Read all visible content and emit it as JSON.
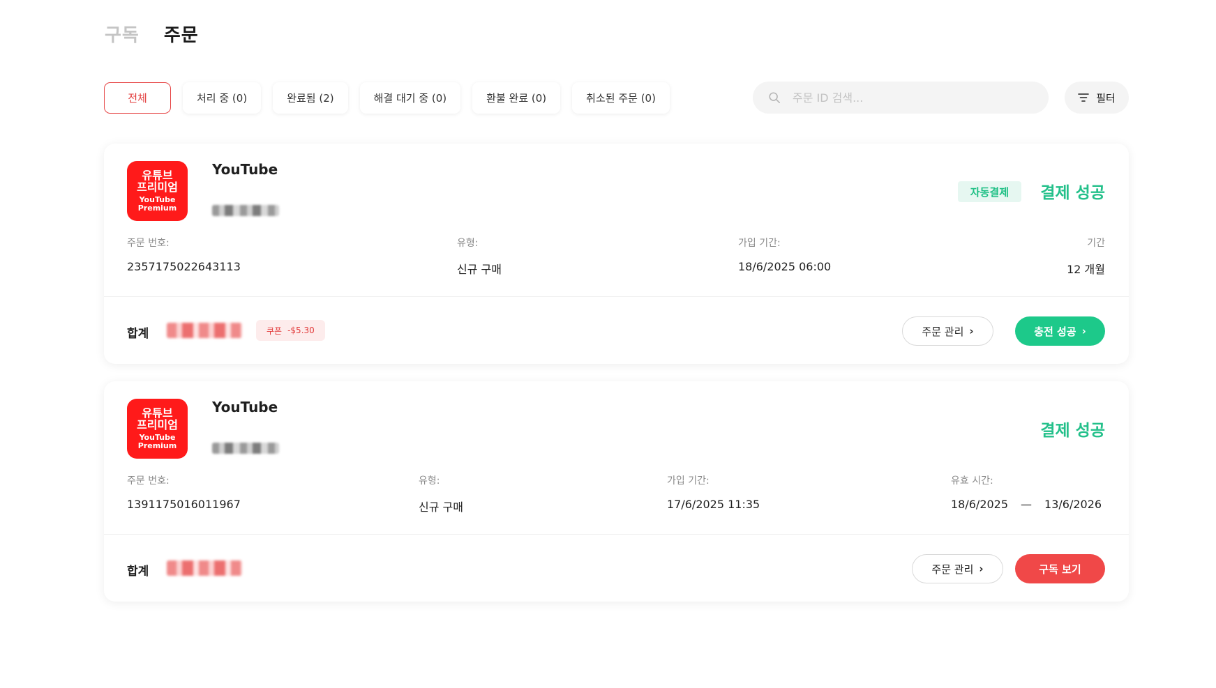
{
  "header": {
    "tabs": [
      {
        "label": "구독",
        "active": false
      },
      {
        "label": "주문",
        "active": true
      }
    ]
  },
  "filters": [
    {
      "label": "전체",
      "active": true
    },
    {
      "label": "처리 중 (0)",
      "active": false
    },
    {
      "label": "완료됨 (2)",
      "active": false
    },
    {
      "label": "해결 대기 중 (0)",
      "active": false
    },
    {
      "label": "환불 완료 (0)",
      "active": false
    },
    {
      "label": "취소된 주문 (0)",
      "active": false
    }
  ],
  "search": {
    "placeholder": "주문 ID 검색...",
    "value": "",
    "icon": "search-icon"
  },
  "filter_button": {
    "label": "필터",
    "icon": "filter-icon"
  },
  "colors": {
    "brand_red": "#e23b3b",
    "success_green": "#23c08a",
    "logo_red": "#ff1a1a"
  },
  "orders": [
    {
      "logo": {
        "line1": "유튜브",
        "line2": "프리미엄",
        "line3": "YouTube",
        "line4": "Premium"
      },
      "service": "YouTube",
      "badge": "자동결제",
      "status": "결제 성공",
      "fields": {
        "order_no_label": "주문 번호:",
        "order_no": "2357175022643113",
        "type_label": "유형:",
        "type": "신규 구매",
        "joined_label": "가입 기간:",
        "joined": "18/6/2025 06:00",
        "period_label": "기간",
        "period": "12 개월"
      },
      "total_label": "합계",
      "coupon": {
        "label": "쿠폰",
        "amount": "-$5.30"
      },
      "manage_label": "주문 관리",
      "primary_label": "충전 성공"
    },
    {
      "logo": {
        "line1": "유튜브",
        "line2": "프리미엄",
        "line3": "YouTube",
        "line4": "Premium"
      },
      "service": "YouTube",
      "status": "결제 성공",
      "fields": {
        "order_no_label": "주문 번호:",
        "order_no": "1391175016011967",
        "type_label": "유형:",
        "type": "신규 구매",
        "joined_label": "가입 기간:",
        "joined": "17/6/2025 11:35",
        "valid_label": "유효 시간:",
        "valid_from": "18/6/2025",
        "valid_sep": "—",
        "valid_to": "13/6/2026"
      },
      "total_label": "합계",
      "manage_label": "주문 관리",
      "primary_label": "구독 보기"
    }
  ]
}
